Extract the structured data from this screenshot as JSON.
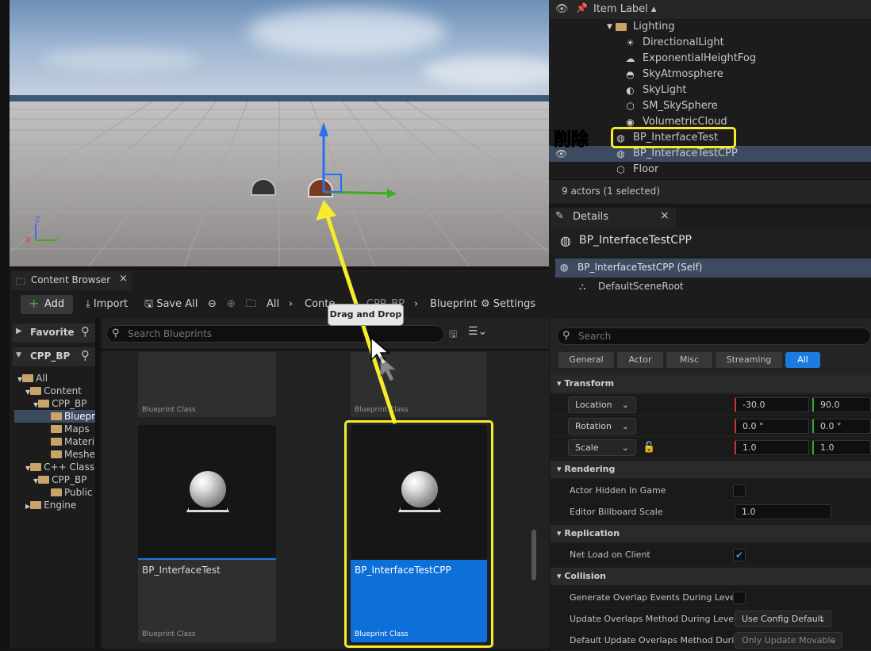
{
  "outliner": {
    "header": "Item Label",
    "items": [
      {
        "label": "Lighting",
        "icon": "folder-icon"
      },
      {
        "label": "DirectionalLight",
        "icon": "directional-light-icon"
      },
      {
        "label": "ExponentialHeightFog",
        "icon": "fog-icon"
      },
      {
        "label": "SkyAtmosphere",
        "icon": "sky-atmosphere-icon"
      },
      {
        "label": "SkyLight",
        "icon": "sky-light-icon"
      },
      {
        "label": "SM_SkySphere",
        "icon": "static-mesh-icon"
      },
      {
        "label": "VolumetricCloud",
        "icon": "cloud-icon"
      },
      {
        "label": "BP_InterfaceTest",
        "icon": "blueprint-actor-icon"
      },
      {
        "label": "BP_InterfaceTestCPP",
        "icon": "blueprint-actor-icon"
      },
      {
        "label": "Floor",
        "icon": "static-mesh-icon"
      }
    ],
    "footer": "9 actors (1 selected)",
    "annotation": "削除"
  },
  "details": {
    "tab": "Details",
    "close": "×",
    "actor_name": "BP_InterfaceTestCPP",
    "self_label": "BP_InterfaceTestCPP (Self)",
    "root_component": "DefaultSceneRoot",
    "search_placeholder": "Search",
    "filter_tabs": [
      "General",
      "Actor",
      "Misc",
      "Streaming",
      "All"
    ],
    "transform": {
      "section": "Transform",
      "location_label": "Location",
      "location_x": "-30.0",
      "location_y": "90.0",
      "rotation_label": "Rotation",
      "rotation_x": "0.0 °",
      "rotation_y": "0.0 °",
      "scale_label": "Scale",
      "scale_x": "1.0",
      "scale_y": "1.0"
    },
    "rendering": {
      "section": "Rendering",
      "hidden_label": "Actor Hidden In Game",
      "billboard_label": "Editor Billboard Scale",
      "billboard_value": "1.0"
    },
    "replication": {
      "section": "Replication",
      "net_load_label": "Net Load on Client"
    },
    "collision": {
      "section": "Collision",
      "overlap_events_label": "Generate Overlap Events During Leve...",
      "update_overlaps_label": "Update Overlaps Method During Leve...",
      "update_overlaps_value": "Use Config Default",
      "default_update_label": "Default Update Overlaps Method Duri...",
      "default_update_value": "Only Update Movable"
    }
  },
  "content_browser": {
    "tab": "Content Browser",
    "close": "×",
    "toolbar": {
      "add": "Add",
      "import": "Import",
      "save_all": "Save All",
      "path": [
        "All",
        "Conte",
        "CPP_BP",
        "Blueprint"
      ],
      "settings": "Settings"
    },
    "favorites": "Favorite",
    "project": "CPP_BP",
    "search_placeholder": "Search Blueprints",
    "tree": [
      {
        "label": "All"
      },
      {
        "label": "Content"
      },
      {
        "label": "CPP_BP"
      },
      {
        "label": "Bluepr"
      },
      {
        "label": "Maps"
      },
      {
        "label": "Materi"
      },
      {
        "label": "Meshe"
      },
      {
        "label": "C++ Class"
      },
      {
        "label": "CPP_BP"
      },
      {
        "label": "Public"
      },
      {
        "label": "Engine"
      }
    ],
    "assets": [
      {
        "name": "",
        "class": "Blueprint Class"
      },
      {
        "name": "",
        "class": "Blueprint Class"
      },
      {
        "name": "BP_InterfaceTest",
        "class": "Blueprint Class"
      },
      {
        "name": "BP_InterfaceTestCPP",
        "class": "Blueprint Class"
      }
    ]
  },
  "tooltip": "Drag and Drop",
  "viewport": {
    "axis_z": "Z",
    "axis_x": "X",
    "axis_y": "Y"
  },
  "colors": {
    "highlight": "#f5ec2a",
    "selection": "#0d6fd8",
    "accent_blue": "#1a7be0"
  }
}
